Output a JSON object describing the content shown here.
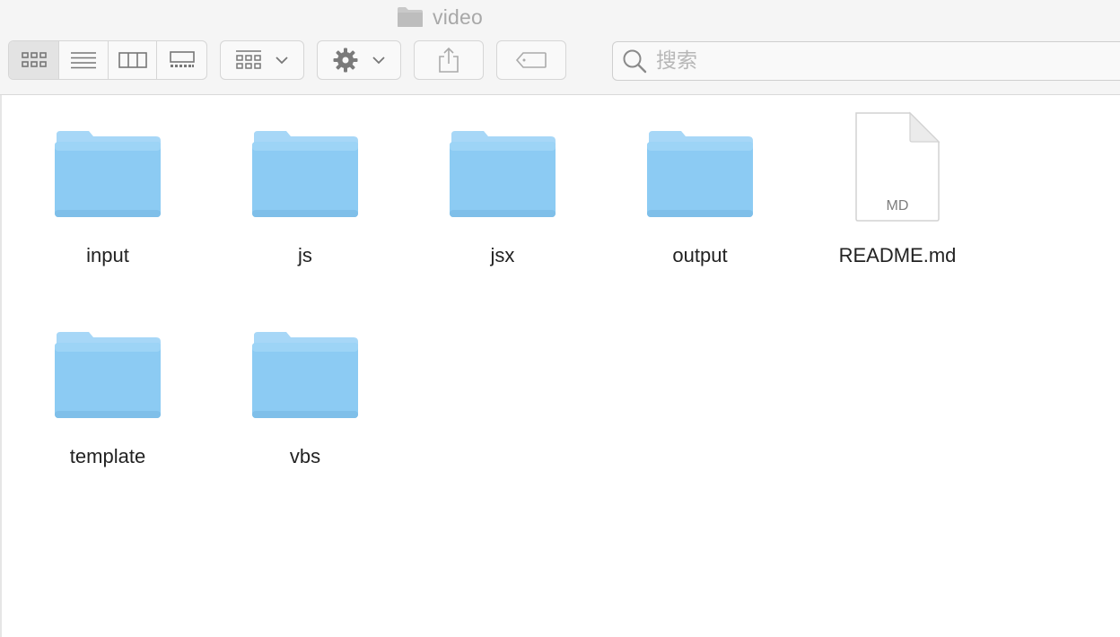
{
  "window": {
    "title": "video"
  },
  "toolbar": {
    "view_modes": [
      "icon-view",
      "list-view",
      "column-view",
      "gallery-view"
    ],
    "active_view": "icon-view",
    "search_placeholder": "搜索"
  },
  "items": [
    {
      "name": "input",
      "kind": "folder"
    },
    {
      "name": "js",
      "kind": "folder"
    },
    {
      "name": "jsx",
      "kind": "folder"
    },
    {
      "name": "output",
      "kind": "folder"
    },
    {
      "name": "README.md",
      "kind": "file",
      "badge": "MD"
    },
    {
      "name": "template",
      "kind": "folder"
    },
    {
      "name": "vbs",
      "kind": "folder"
    }
  ],
  "colors": {
    "folder_top": "#a7d7f7",
    "folder_body": "#8ccbf3",
    "toolbar_bg": "#f5f5f5",
    "icon_gray": "#8a8a8a"
  }
}
